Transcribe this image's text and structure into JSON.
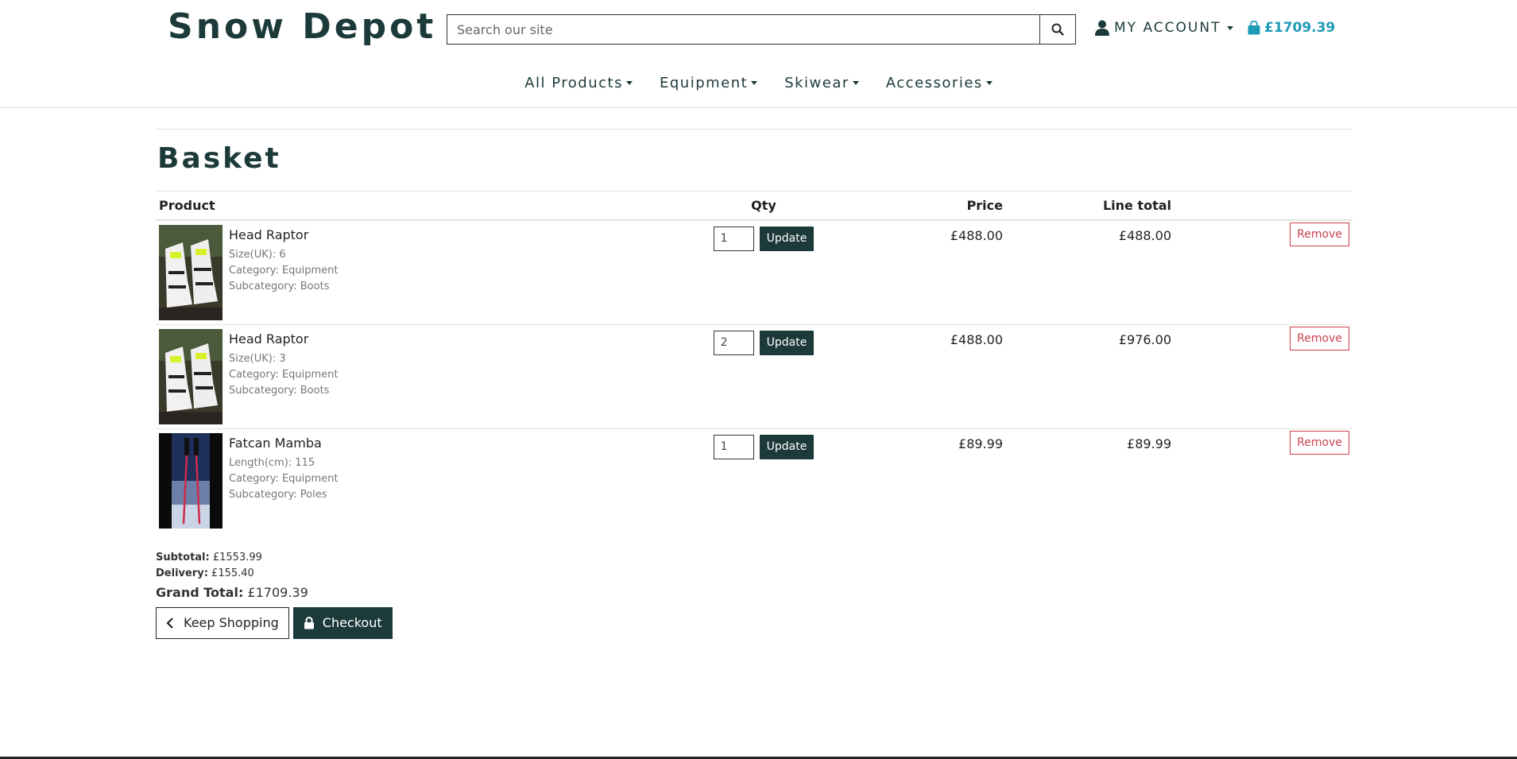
{
  "brand": {
    "name": "Snow Depot",
    "color": "#1d3a3a",
    "accent": "#1e9bb5",
    "danger": "#c9414e"
  },
  "search": {
    "placeholder": "Search our site",
    "icon": "search-icon"
  },
  "account": {
    "label": "MY ACCOUNT",
    "icon": "user-icon"
  },
  "cart": {
    "total": "£1709.39",
    "icon": "shopping-bag-icon"
  },
  "nav": [
    {
      "label": "All Products"
    },
    {
      "label": "Equipment"
    },
    {
      "label": "Skiwear"
    },
    {
      "label": "Accessories"
    }
  ],
  "page": {
    "title": "Basket"
  },
  "table": {
    "headers": {
      "product": "Product",
      "qty": "Qty",
      "price": "Price",
      "line_total": "Line total"
    },
    "rows": [
      {
        "name": "Head Raptor",
        "attr": "Size(UK): 6",
        "category": "Category: Equipment",
        "subcategory": "Subcategory: Boots",
        "qty": "1",
        "update_label": "Update",
        "price": "£488.00",
        "line_total": "£488.00",
        "remove_label": "Remove"
      },
      {
        "name": "Head Raptor",
        "attr": "Size(UK): 3",
        "category": "Category: Equipment",
        "subcategory": "Subcategory: Boots",
        "qty": "2",
        "update_label": "Update",
        "price": "£488.00",
        "line_total": "£976.00",
        "remove_label": "Remove"
      },
      {
        "name": "Fatcan Mamba",
        "attr": "Length(cm): 115",
        "category": "Category: Equipment",
        "subcategory": "Subcategory: Poles",
        "qty": "1",
        "update_label": "Update",
        "price": "£89.99",
        "line_total": "£89.99",
        "remove_label": "Remove"
      }
    ]
  },
  "totals": {
    "subtotal_label": "Subtotal:",
    "subtotal": "£1553.99",
    "delivery_label": "Delivery:",
    "delivery": "£155.40",
    "grand_label": "Grand Total:",
    "grand": "£1709.39"
  },
  "actions": {
    "keep_shopping": "Keep Shopping",
    "checkout": "Checkout"
  }
}
